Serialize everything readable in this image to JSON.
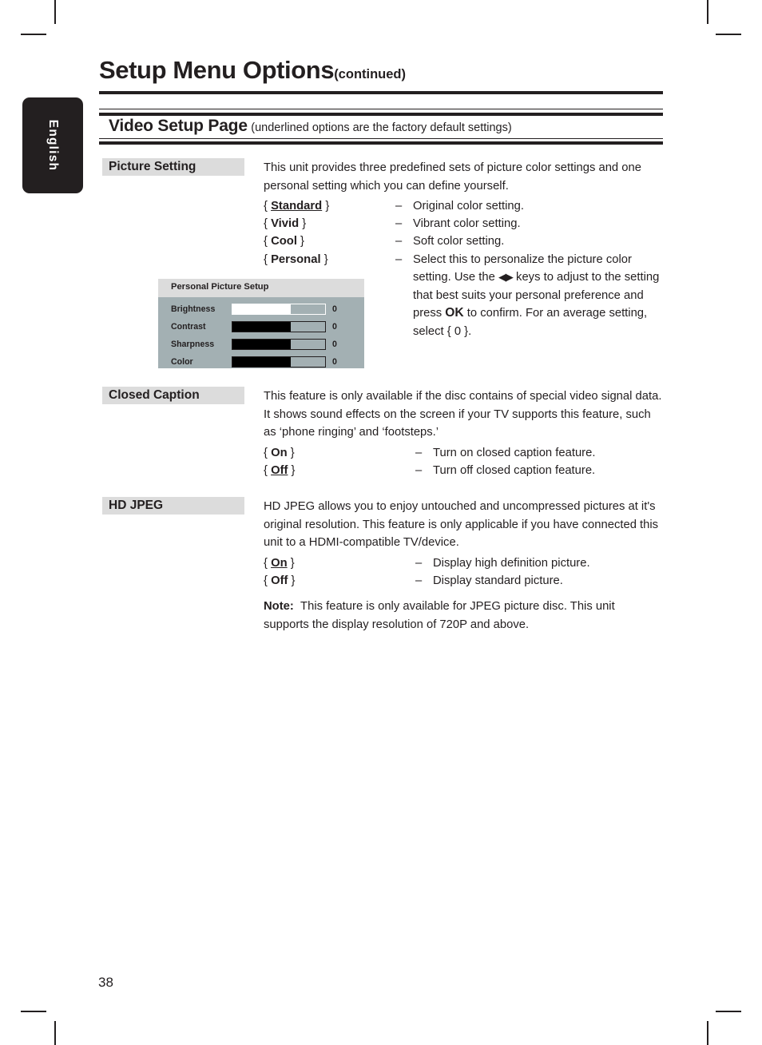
{
  "page": {
    "title": "Setup Menu Options",
    "title_continued": "(continued)",
    "number": "38",
    "language_tab": "English"
  },
  "banner": {
    "title": "Video Setup Page",
    "subtitle": "(underlined options are the factory default settings)"
  },
  "sections": [
    {
      "label": "Picture Setting",
      "intro": "This unit provides three predefined sets of picture color settings and one personal setting which you can define yourself.",
      "options": [
        {
          "key_open": "{",
          "key": "Standard",
          "key_close": "}",
          "underlined": true,
          "dash": "–",
          "desc": "Original color setting."
        },
        {
          "key_open": "{",
          "key": "Vivid",
          "key_close": "}",
          "underlined": false,
          "dash": "–",
          "desc": "Vibrant color setting."
        },
        {
          "key_open": "{",
          "key": "Cool",
          "key_close": "}",
          "underlined": false,
          "dash": "–",
          "desc": "Soft color setting."
        },
        {
          "key_open": "{",
          "key": "Personal",
          "key_close": "}",
          "underlined": false,
          "dash": "–",
          "desc_parts": [
            "Select this to personalize the picture color setting. Use the ",
            "◀▶",
            " keys to adjust to the setting that best suits your personal preference and press ",
            "OK",
            " to confirm. For an average setting, select { 0 }."
          ]
        }
      ]
    },
    {
      "label": "Closed Caption",
      "intro": "This feature is only available if the disc contains of special video signal data. It shows sound effects on the screen if your TV supports this feature, such as ‘phone ringing’ and ‘footsteps.’",
      "options": [
        {
          "key_open": "{",
          "key": "On",
          "key_close": "}",
          "underlined": false,
          "dash": "–",
          "desc": "Turn on closed caption feature."
        },
        {
          "key_open": "{",
          "key": "Off",
          "key_close": "}",
          "underlined": true,
          "dash": "–",
          "desc": "Turn off closed caption feature."
        }
      ]
    },
    {
      "label": "HD JPEG",
      "intro": "HD JPEG allows you to enjoy untouched and uncompressed pictures at it's original resolution. This feature is only applicable if you have connected this unit to a HDMI-compatible TV/device.",
      "options": [
        {
          "key_open": "{",
          "key": "On",
          "key_close": "}",
          "underlined": true,
          "dash": "–",
          "desc": "Display high definition picture."
        },
        {
          "key_open": "{",
          "key": "Off",
          "key_close": "}",
          "underlined": false,
          "dash": "–",
          "desc": "Display standard picture."
        }
      ],
      "note_label": "Note:",
      "note_text": "This feature is only available for JPEG picture disc. This unit supports the display resolution of 720P and above."
    }
  ],
  "osd_screenshot": {
    "title": "Personal Picture Setup",
    "rows": [
      {
        "label": "Brightness",
        "value": "0",
        "fill_percent": 63,
        "selected": true
      },
      {
        "label": "Contrast",
        "value": "0",
        "fill_percent": 63,
        "selected": false
      },
      {
        "label": "Sharpness",
        "value": "0",
        "fill_percent": 63,
        "selected": false
      },
      {
        "label": "Color",
        "value": "0",
        "fill_percent": 63,
        "selected": false
      }
    ],
    "colors": {
      "header_bg": "#dcdcdc",
      "body_bg": "#a3b0b3",
      "bar_border": "#231f20",
      "bar_fill": "#000000",
      "selected_fill": "#ffffff"
    }
  }
}
